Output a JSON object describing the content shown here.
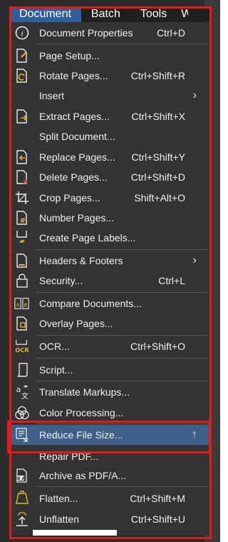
{
  "menubar": {
    "items": [
      {
        "label": "Document"
      },
      {
        "label": "Batch"
      },
      {
        "label": "Tools"
      },
      {
        "label": "W"
      }
    ]
  },
  "menu": {
    "items": [
      {
        "label": "Document Properties",
        "shortcut": "Ctrl+D",
        "icon": "info-icon"
      },
      {
        "label": "Page Setup...",
        "shortcut": "",
        "icon": "page-setup-icon"
      },
      {
        "label": "Rotate Pages...",
        "shortcut": "Ctrl+Shift+R",
        "icon": "rotate-pages-icon"
      },
      {
        "label": "Insert",
        "shortcut": "",
        "icon": "",
        "submenu": true
      },
      {
        "label": "Extract Pages...",
        "shortcut": "Ctrl+Shift+X",
        "icon": "extract-pages-icon"
      },
      {
        "label": "Split Document...",
        "shortcut": "",
        "icon": ""
      },
      {
        "label": "Replace Pages...",
        "shortcut": "Ctrl+Shift+Y",
        "icon": "replace-pages-icon"
      },
      {
        "label": "Delete Pages...",
        "shortcut": "Ctrl+Shift+D",
        "icon": "delete-pages-icon"
      },
      {
        "label": "Crop Pages...",
        "shortcut": "Shift+Alt+O",
        "icon": "crop-icon"
      },
      {
        "label": "Number Pages...",
        "shortcut": "",
        "icon": "number-pages-icon"
      },
      {
        "label": "Create Page Labels...",
        "shortcut": "",
        "icon": "page-labels-icon"
      },
      {
        "label": "Headers & Footers",
        "shortcut": "",
        "icon": "headers-footers-icon",
        "submenu": true
      },
      {
        "label": "Security...",
        "shortcut": "Ctrl+L",
        "icon": "lock-icon"
      },
      {
        "label": "Compare Documents...",
        "shortcut": "",
        "icon": "compare-icon"
      },
      {
        "label": "Overlay Pages...",
        "shortcut": "",
        "icon": "overlay-icon"
      },
      {
        "label": "OCR...",
        "shortcut": "Ctrl+Shift+O",
        "icon": "ocr-icon"
      },
      {
        "label": "Script...",
        "shortcut": "",
        "icon": "script-icon"
      },
      {
        "label": "Translate Markups...",
        "shortcut": "",
        "icon": "translate-icon"
      },
      {
        "label": "Color Processing...",
        "shortcut": "",
        "icon": "color-processing-icon"
      },
      {
        "label": "Reduce File Size...",
        "shortcut": "",
        "icon": "reduce-file-size-icon",
        "highlighted": true,
        "pin": "†"
      },
      {
        "label": "Repair PDF...",
        "shortcut": "",
        "icon": ""
      },
      {
        "label": "Archive as PDF/A...",
        "shortcut": "",
        "icon": "archive-pdfa-icon"
      },
      {
        "label": "Flatten...",
        "shortcut": "Ctrl+Shift+M",
        "icon": "flatten-icon"
      },
      {
        "label": "Unflatten",
        "shortcut": "Ctrl+Shift+U",
        "icon": "unflatten-icon"
      }
    ],
    "ocr_icon_text": "OCR",
    "archive_icon_text": "IB A",
    "compare_icon_text": "A B"
  },
  "colors": {
    "menu_bg": "#333333",
    "highlight": "#3e5f88",
    "accent_icon": "#d9b62a",
    "annotation": "#e31b1b"
  }
}
